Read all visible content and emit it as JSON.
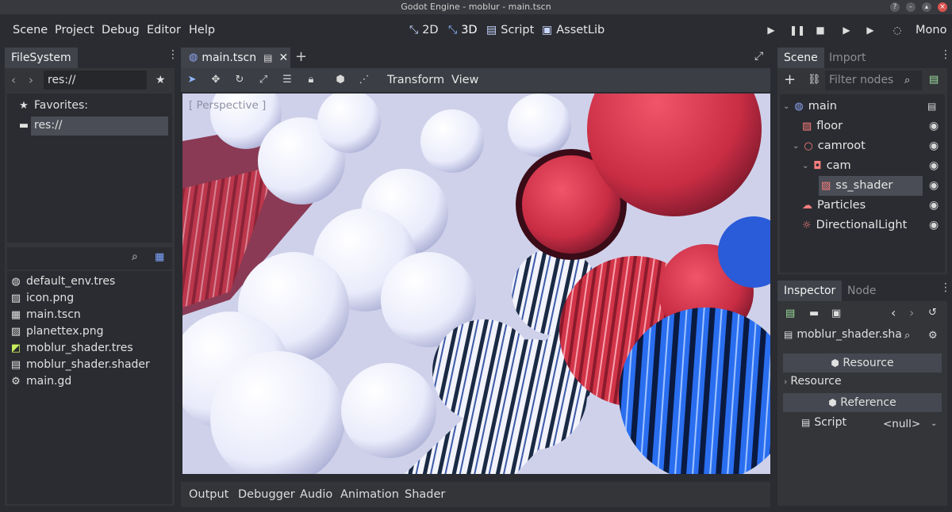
{
  "window": {
    "title": "Godot Engine - moblur - main.tscn"
  },
  "menu": {
    "items": [
      "Scene",
      "Project",
      "Debug",
      "Editor",
      "Help"
    ]
  },
  "workspaces": [
    {
      "label": "2D",
      "icon": "2d-icon"
    },
    {
      "label": "3D",
      "icon": "3d-icon",
      "active": true
    },
    {
      "label": "Script",
      "icon": "script-icon"
    },
    {
      "label": "AssetLib",
      "icon": "assetlib-icon"
    }
  ],
  "playtest": {
    "renderer": "Mono"
  },
  "filesystem": {
    "tab": "FileSystem",
    "path": "res://",
    "favorites_label": "Favorites:",
    "root_label": "res://",
    "files": [
      {
        "name": "default_env.tres",
        "icon": "environment-icon"
      },
      {
        "name": "icon.png",
        "icon": "image-icon"
      },
      {
        "name": "main.tscn",
        "icon": "scene-file-icon"
      },
      {
        "name": "planettex.png",
        "icon": "image-icon"
      },
      {
        "name": "moblur_shader.tres",
        "icon": "shader-material-icon"
      },
      {
        "name": "moblur_shader.shader",
        "icon": "shader-file-icon"
      },
      {
        "name": "main.gd",
        "icon": "gdscript-icon"
      }
    ]
  },
  "editor": {
    "scene_tab": "main.tscn",
    "toolbar_menus": [
      "Transform",
      "View"
    ],
    "viewport_label": "[ Perspective ]"
  },
  "scene_dock": {
    "tabs": [
      "Scene",
      "Import"
    ],
    "filter_placeholder": "Filter nodes",
    "nodes": [
      {
        "name": "main",
        "icon": "spatial-node-icon",
        "depth": 0,
        "color": "#8da5f3"
      },
      {
        "name": "floor",
        "icon": "mesh-instance-icon",
        "depth": 1,
        "color": "#fc7f7f"
      },
      {
        "name": "camroot",
        "icon": "position-node-icon",
        "depth": 1,
        "color": "#fc7f7f"
      },
      {
        "name": "cam",
        "icon": "camera-icon",
        "depth": 2,
        "color": "#fc7f7f"
      },
      {
        "name": "ss_shader",
        "icon": "mesh-instance-icon",
        "depth": 3,
        "color": "#fc7f7f",
        "selected": true
      },
      {
        "name": "Particles",
        "icon": "particles-icon",
        "depth": 1,
        "color": "#fc7f7f"
      },
      {
        "name": "DirectionalLight",
        "icon": "light-icon",
        "depth": 1,
        "color": "#fc7f7f"
      }
    ]
  },
  "inspector": {
    "tabs": [
      "Inspector",
      "Node"
    ],
    "resource_name": "moblur_shader.sha",
    "sections": {
      "resource_header": "Resource",
      "resource_group": "Resource",
      "reference_header": "Reference"
    },
    "script_label": "Script",
    "script_value": "<null>"
  },
  "bottom_panel": {
    "tabs": [
      "Output",
      "Debugger",
      "Audio",
      "Animation",
      "Shader"
    ]
  }
}
